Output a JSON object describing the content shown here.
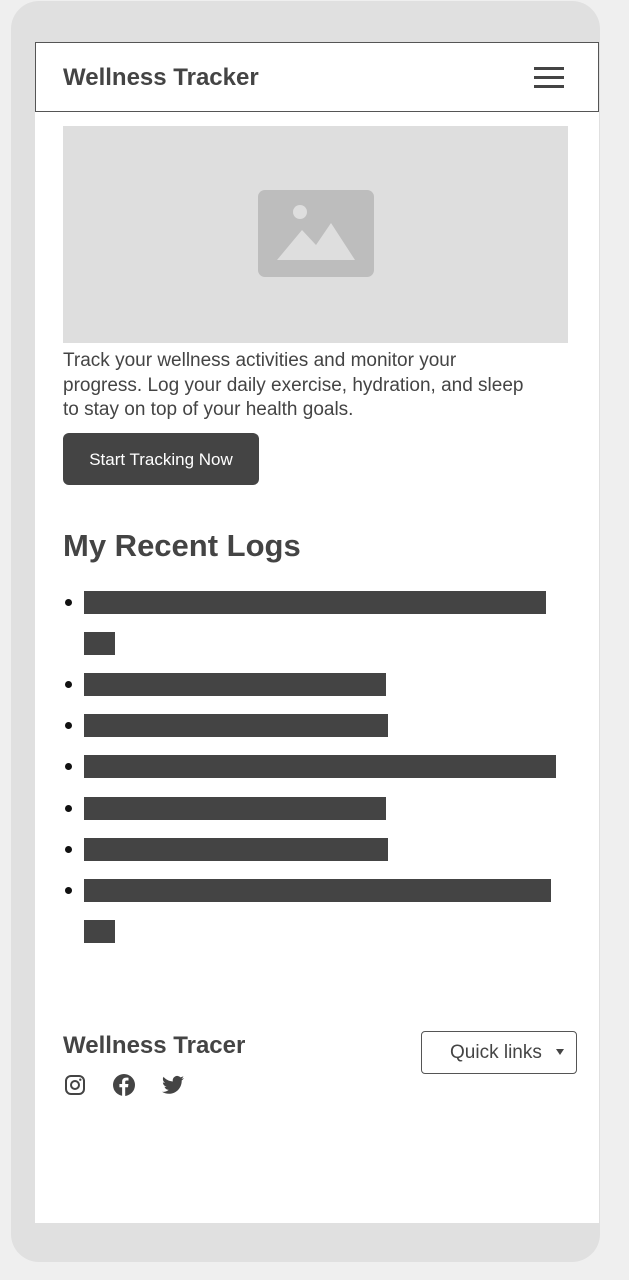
{
  "header": {
    "title": "Wellness Tracker",
    "menu_icon": "hamburger-menu-icon"
  },
  "hero": {
    "image_icon": "image-placeholder-icon"
  },
  "intro": {
    "text": "Track your wellness activities and monitor your progress. Log your daily exercise, hydration, and sleep to stay on top of your health goals."
  },
  "cta": {
    "label": "Start Tracking Now"
  },
  "logs": {
    "title": "My Recent Logs",
    "item_count": 7
  },
  "footer": {
    "title": "Wellness Tracer",
    "social_icons": [
      "instagram-icon",
      "facebook-icon",
      "twitter-icon"
    ],
    "quick_links_label": "Quick links"
  },
  "colors": {
    "text": "#444444",
    "placeholder_bg": "#dedede",
    "frame": "#e0e0e0"
  }
}
